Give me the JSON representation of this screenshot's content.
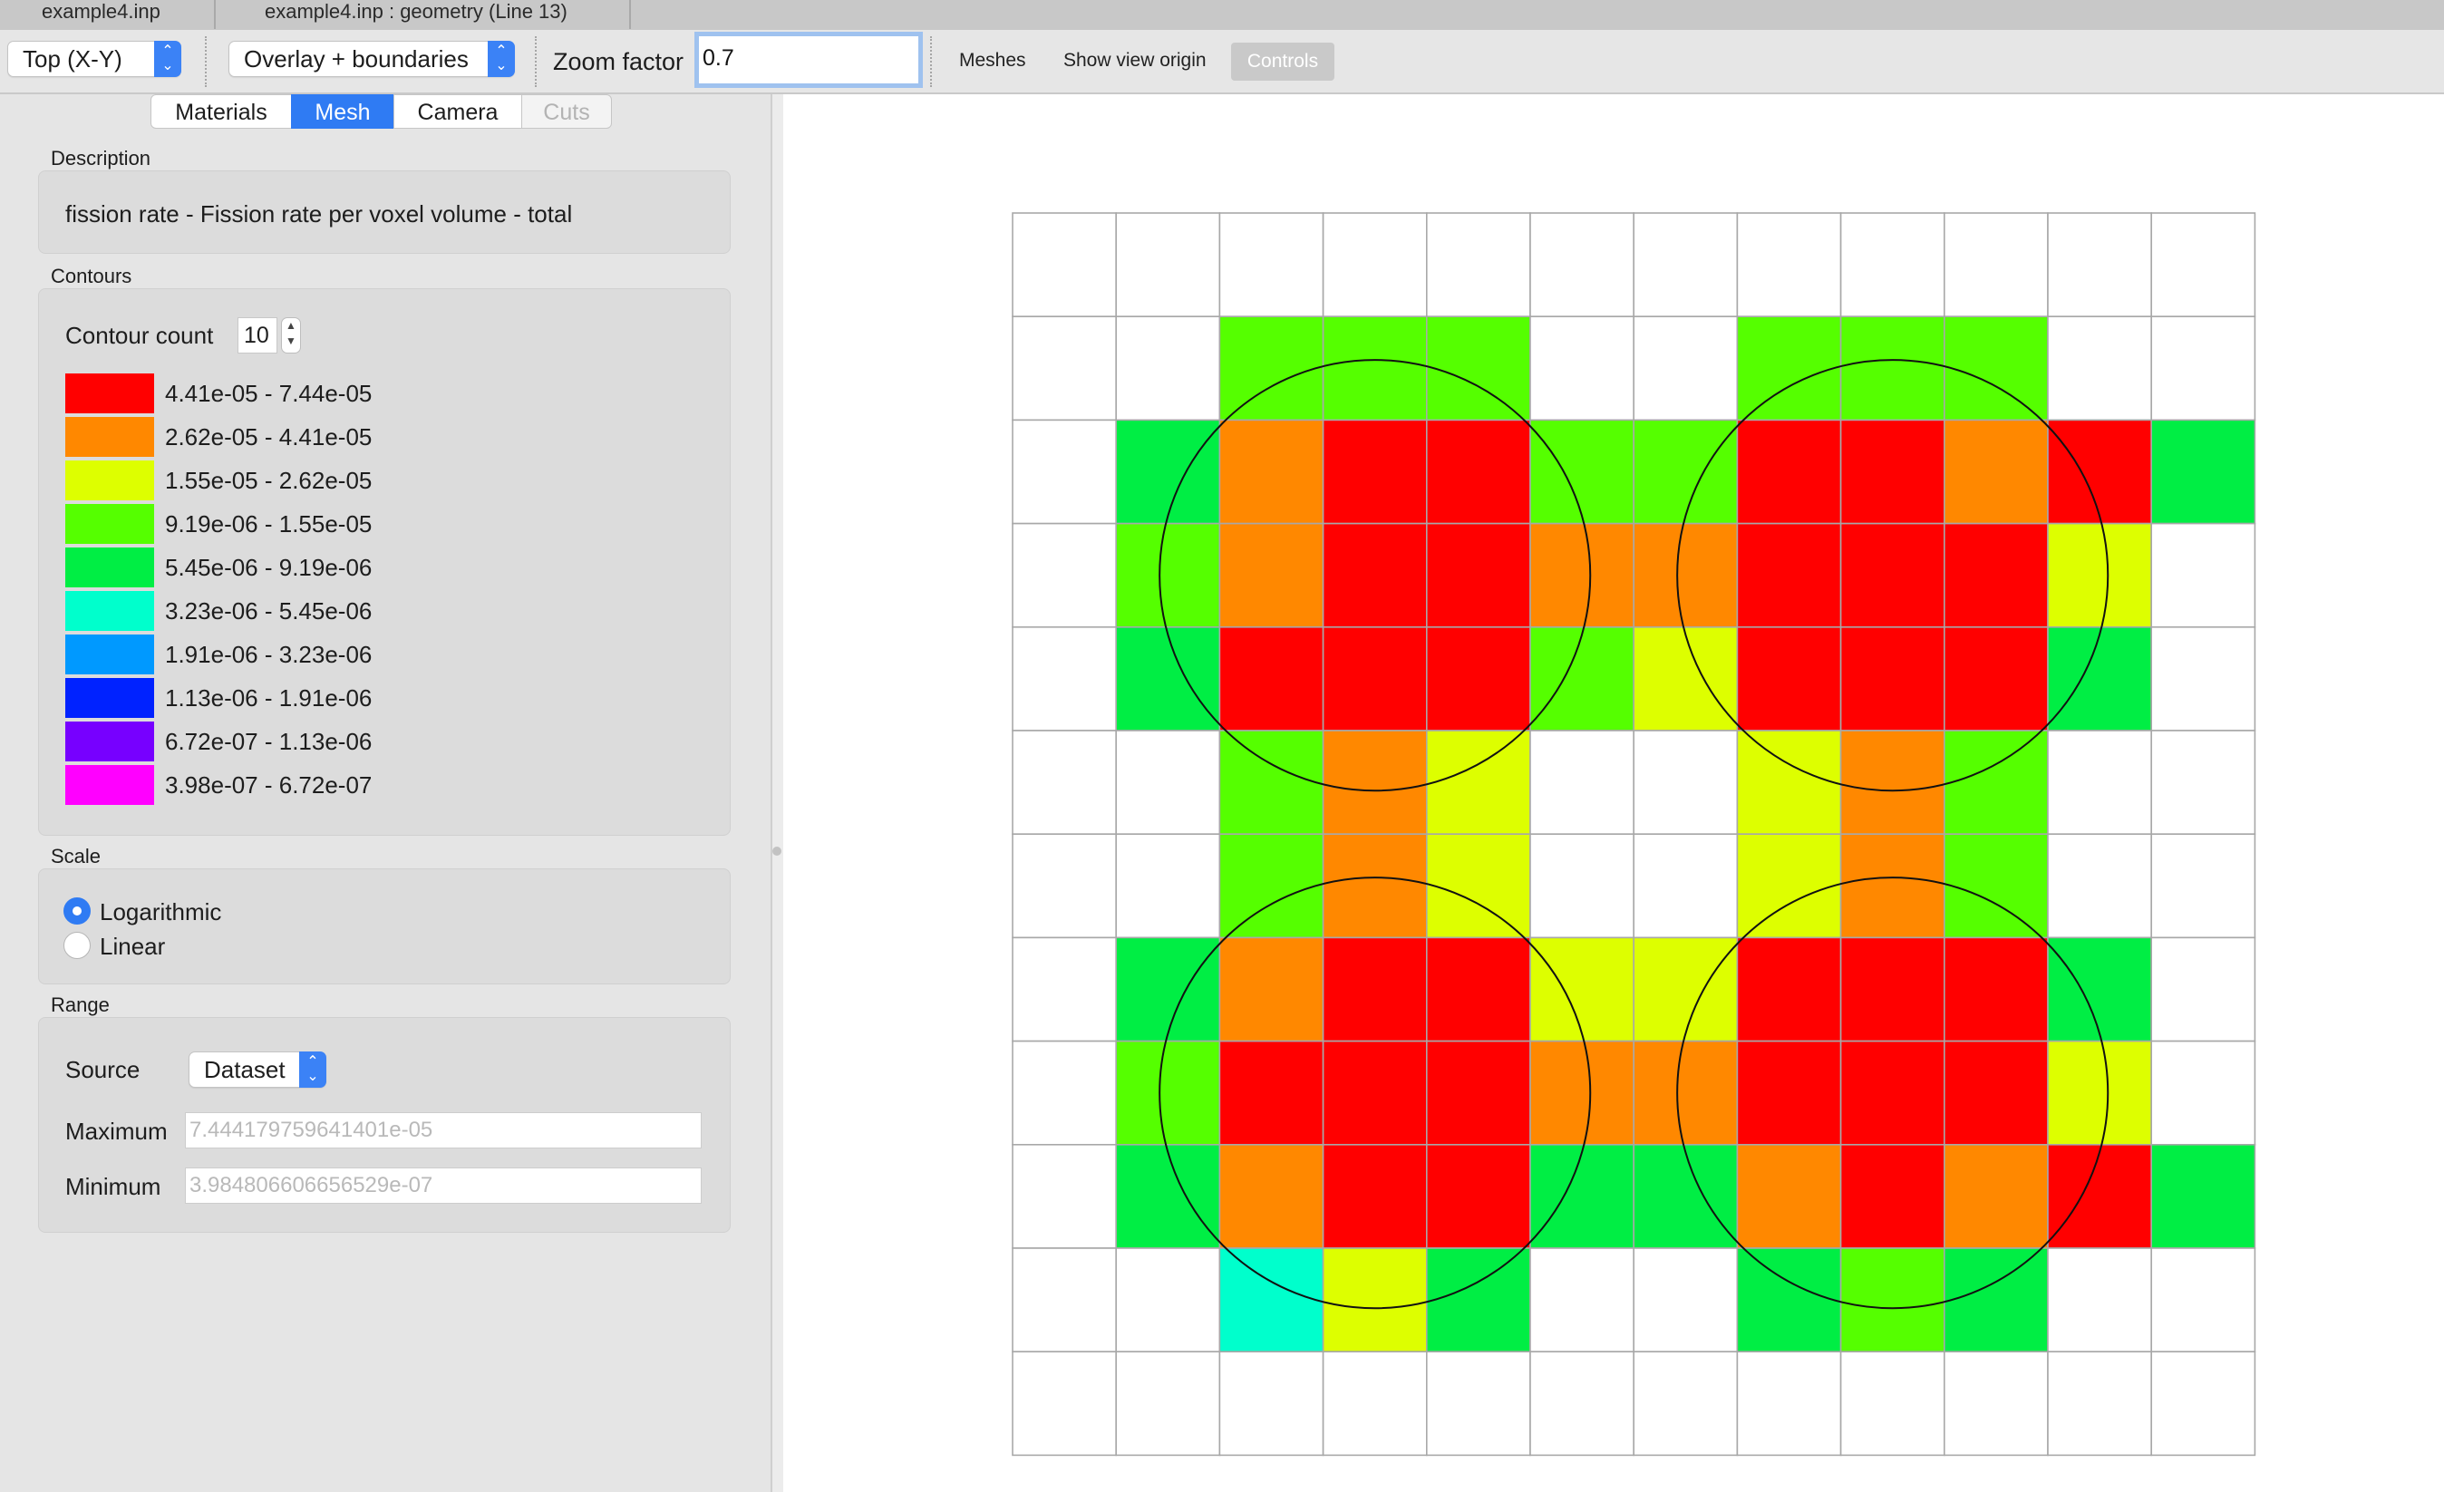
{
  "tabs": [
    {
      "label": "example4.inp"
    },
    {
      "label": "example4.inp : geometry (Line 13)"
    }
  ],
  "toolbar": {
    "view_select": "Top (X-Y)",
    "overlay_select": "Overlay + boundaries",
    "zoom_label": "Zoom factor",
    "zoom_value": "0.7",
    "meshes_label": "Meshes",
    "show_origin_label": "Show view origin",
    "controls_label": "Controls"
  },
  "panel_tabs": [
    {
      "label": "Materials"
    },
    {
      "label": "Mesh"
    },
    {
      "label": "Camera"
    },
    {
      "label": "Cuts"
    }
  ],
  "description": {
    "section": "Description",
    "text": "fission rate - Fission rate per voxel volume - total"
  },
  "contours": {
    "section": "Contours",
    "count_label": "Contour count",
    "count_value": "10",
    "legend": [
      {
        "range": "4.41e-05 - 7.44e-05",
        "color": "#ff0000"
      },
      {
        "range": "2.62e-05 - 4.41e-05",
        "color": "#ff8800"
      },
      {
        "range": "1.55e-05 - 2.62e-05",
        "color": "#ddff00"
      },
      {
        "range": "9.19e-06 - 1.55e-05",
        "color": "#55ff00"
      },
      {
        "range": "5.45e-06 - 9.19e-06",
        "color": "#00ee44"
      },
      {
        "range": "3.23e-06 - 5.45e-06",
        "color": "#00ffcc"
      },
      {
        "range": "1.91e-06 - 3.23e-06",
        "color": "#0099ff"
      },
      {
        "range": "1.13e-06 - 1.91e-06",
        "color": "#0022ff"
      },
      {
        "range": "6.72e-07 - 1.13e-06",
        "color": "#7700ff"
      },
      {
        "range": "3.98e-07 - 6.72e-07",
        "color": "#ff00ff"
      }
    ]
  },
  "scale": {
    "section": "Scale",
    "options": [
      "Logarithmic",
      "Linear"
    ],
    "selected": "Logarithmic"
  },
  "range": {
    "section": "Range",
    "source_label": "Source",
    "source_value": "Dataset",
    "max_label": "Maximum",
    "max_value": "7.444179759641401e-05",
    "min_label": "Minimum",
    "min_value": "3.984806606656529e-07"
  },
  "mesh_grid": {
    "rows": 12,
    "cols": 12,
    "palette": {
      "R": "#ff0000",
      "O": "#ff8800",
      "Y": "#ddff00",
      "L": "#55ff00",
      "G": "#00ee44",
      "C": "#00ffcc",
      "W": "#ffffff"
    },
    "cells": [
      "WWWWWWWWWWWW",
      "WWLLLWWLLLWW",
      "WGORRLLRRORG",
      "WLORROORRRYW",
      "WGRRRLYRRRGW",
      "WWLOYWWYOLWW",
      "WWLOYWWYOLWW",
      "WGORRYYRRRGW",
      "WLRRROORRRYW",
      "WGORRGGORORG",
      "WWCYGWWGLGWW",
      "WWWWWWWWWWWW"
    ],
    "fuel_pin_centers": [
      [
        3.5,
        3.5
      ],
      [
        8.5,
        3.5
      ],
      [
        3.5,
        8.5
      ],
      [
        8.5,
        8.5
      ]
    ],
    "fuel_pin_radius": 2.08
  }
}
